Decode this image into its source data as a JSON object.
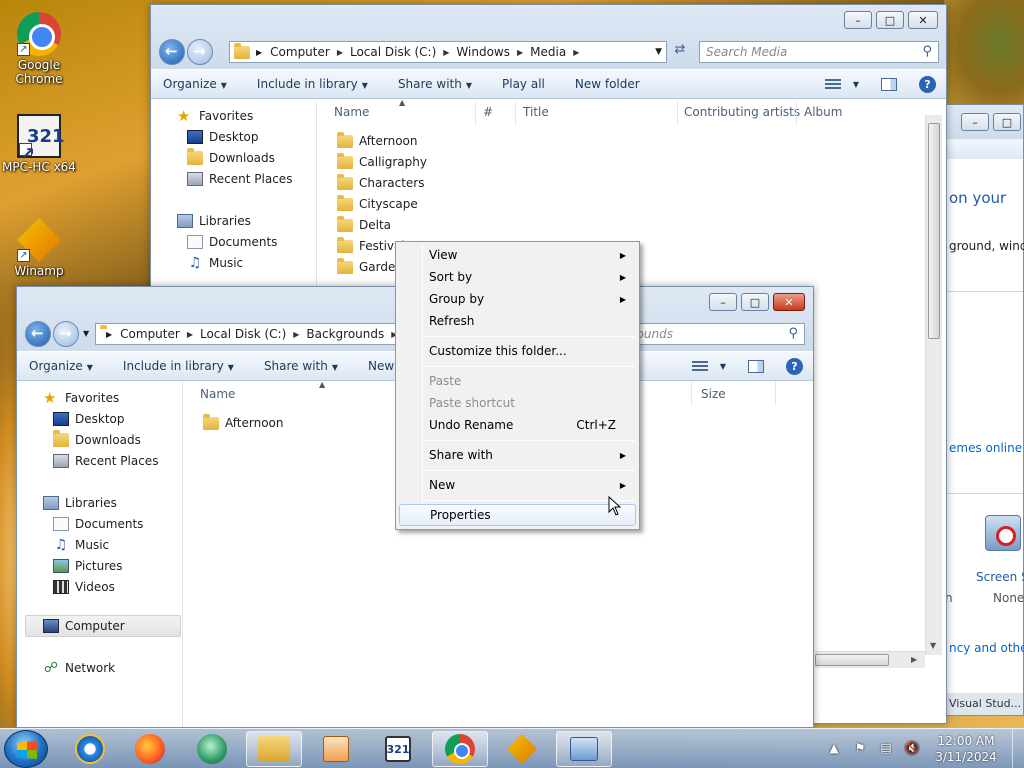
{
  "desktop": {
    "icons": [
      {
        "label": "Google Chrome",
        "icon": "chrome-icon"
      },
      {
        "label": "MPC-HC x64",
        "icon": "mpc-hc-icon",
        "badge": "321"
      },
      {
        "label": "Winamp",
        "icon": "winamp-icon"
      }
    ]
  },
  "back_window": {
    "breadcrumb": [
      "Computer",
      "Local Disk (C:)",
      "Windows",
      "Media"
    ],
    "search_placeholder": "Search Media",
    "toolbar": [
      "Organize",
      "Include in library",
      "Share with",
      "Play all",
      "New folder"
    ],
    "nav": {
      "favorites": "Favorites",
      "favorites_items": [
        "Desktop",
        "Downloads",
        "Recent Places"
      ],
      "libraries": "Libraries",
      "libraries_items": [
        "Documents",
        "Music"
      ]
    },
    "columns": [
      "Name",
      "#",
      "Title",
      "Contributing artists",
      "Album"
    ],
    "files": [
      "Afternoon",
      "Calligraphy",
      "Characters",
      "Cityscape",
      "Delta",
      "Festival",
      "Garden"
    ]
  },
  "front_window": {
    "breadcrumb": [
      "Computer",
      "Local Disk (C:)",
      "Backgrounds"
    ],
    "search_placeholder": "grounds",
    "toolbar": [
      "Organize",
      "Include in library",
      "Share with",
      "New f"
    ],
    "nav": {
      "favorites": "Favorites",
      "favorites_items": [
        "Desktop",
        "Downloads",
        "Recent Places"
      ],
      "libraries": "Libraries",
      "libraries_items": [
        "Documents",
        "Music",
        "Pictures",
        "Videos"
      ],
      "computer": "Computer",
      "network": "Network"
    },
    "columns": [
      "Name",
      "Size"
    ],
    "files": [
      "Afternoon"
    ]
  },
  "context_menu": {
    "items": [
      {
        "label": "View",
        "submenu": true,
        "enabled": true
      },
      {
        "label": "Sort by",
        "submenu": true,
        "enabled": true
      },
      {
        "label": "Group by",
        "submenu": true,
        "enabled": true
      },
      {
        "label": "Refresh",
        "submenu": false,
        "enabled": true
      },
      {
        "label": "Customize this folder...",
        "submenu": false,
        "enabled": true
      },
      {
        "label": "Paste",
        "submenu": false,
        "enabled": false
      },
      {
        "label": "Paste shortcut",
        "submenu": false,
        "enabled": false
      },
      {
        "label": "Undo Rename",
        "submenu": false,
        "enabled": true,
        "shortcut": "Ctrl+Z"
      },
      {
        "label": "Share with",
        "submenu": true,
        "enabled": true
      },
      {
        "label": "New",
        "submenu": true,
        "enabled": true
      },
      {
        "label": "Properties",
        "submenu": false,
        "enabled": true,
        "highlighted": true
      }
    ]
  },
  "right_window": {
    "heading": "on your",
    "desc": "ground, windo",
    "link": "emes online",
    "item_label": "Screen Sa",
    "item_value": "None",
    "left_frag": "n",
    "bottom_link": "ncy and other",
    "footer": "Visual Stud..."
  },
  "taskbar": {
    "apps": [
      "internet-explorer",
      "firefox",
      "green-app",
      "windows-explorer",
      "media-player",
      "mpc-hc",
      "chrome",
      "winamp",
      "control-panel"
    ],
    "clock_time": "12:00 AM",
    "clock_date": "3/11/2024"
  },
  "colors": {
    "accent": "#1e395b",
    "link": "#0066cc",
    "heading": "#1e5aa8"
  }
}
